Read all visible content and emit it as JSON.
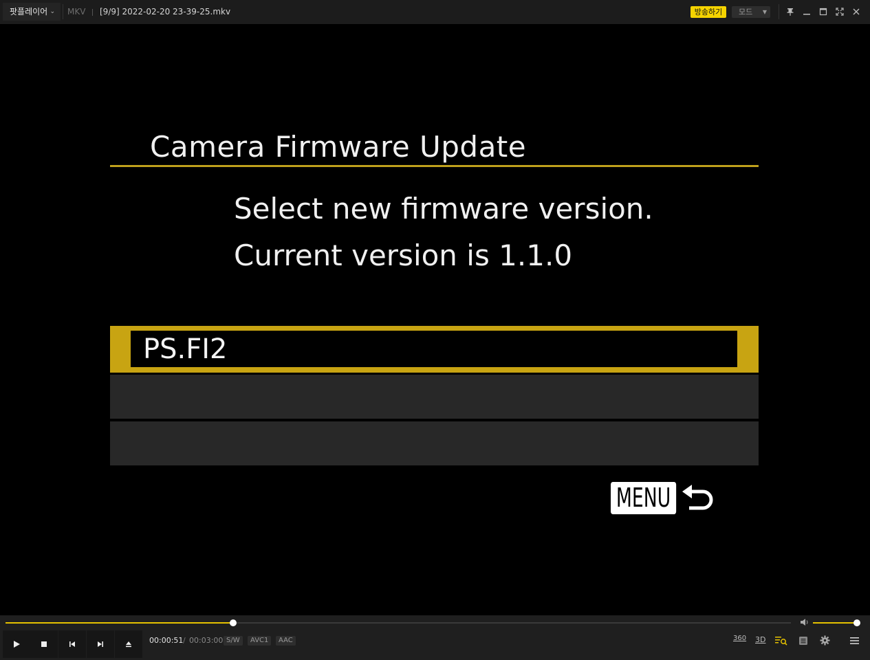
{
  "titlebar": {
    "app_name": "팟플레이어",
    "format": "MKV",
    "file": "[9/9]  2022-02-20  23-39-25.mkv",
    "broadcast": "방송하기",
    "mode": "모드"
  },
  "screen": {
    "title": "Camera Firmware Update",
    "prompt_line1": "Select new firmware version.",
    "prompt_line2": "Current version is 1.1.0",
    "firmware_items": [
      "PS.FI2",
      "",
      ""
    ],
    "menu_label": "MENU"
  },
  "player": {
    "time_current": "00:00:51",
    "time_separator": "/",
    "time_total": "00:03:00",
    "progress_fraction": 0.29,
    "volume_fraction": 1.0,
    "badges": [
      "S/W",
      "AVC1",
      "AAC"
    ],
    "right_icons": [
      "360",
      "3D"
    ]
  },
  "colors": {
    "accent": "#e6c200",
    "camera_yellow": "#c8a412",
    "broadcast": "#f5d300"
  }
}
